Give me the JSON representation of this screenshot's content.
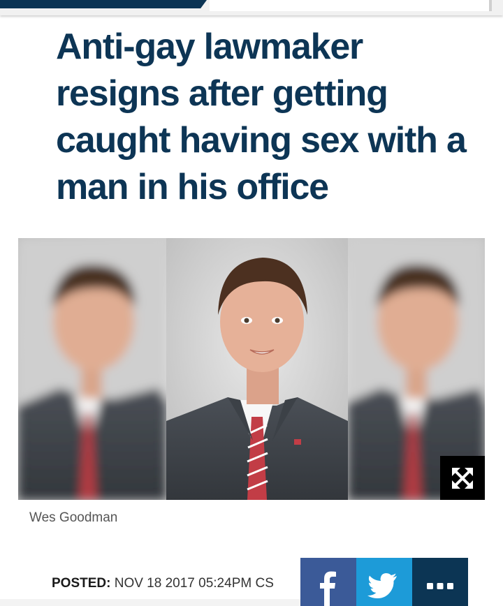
{
  "article": {
    "title": "Anti-gay lawmaker resigns after getting caught having sex with a man in his office",
    "photo_caption": "Wes Goodman",
    "posted_label": "POSTED:",
    "posted_value": "NOV 18 2017 05:24PM CS"
  },
  "share": {
    "icons": [
      "facebook-icon",
      "twitter-icon",
      "more-icon"
    ],
    "colors": {
      "facebook": "#3b5a98",
      "twitter": "#1d9bd8",
      "more": "#0c3554"
    }
  },
  "photo": {
    "expand_icon": "expand-icon"
  },
  "theme": {
    "headline_color": "#0d3555",
    "nav_accent": "#0b3353"
  }
}
